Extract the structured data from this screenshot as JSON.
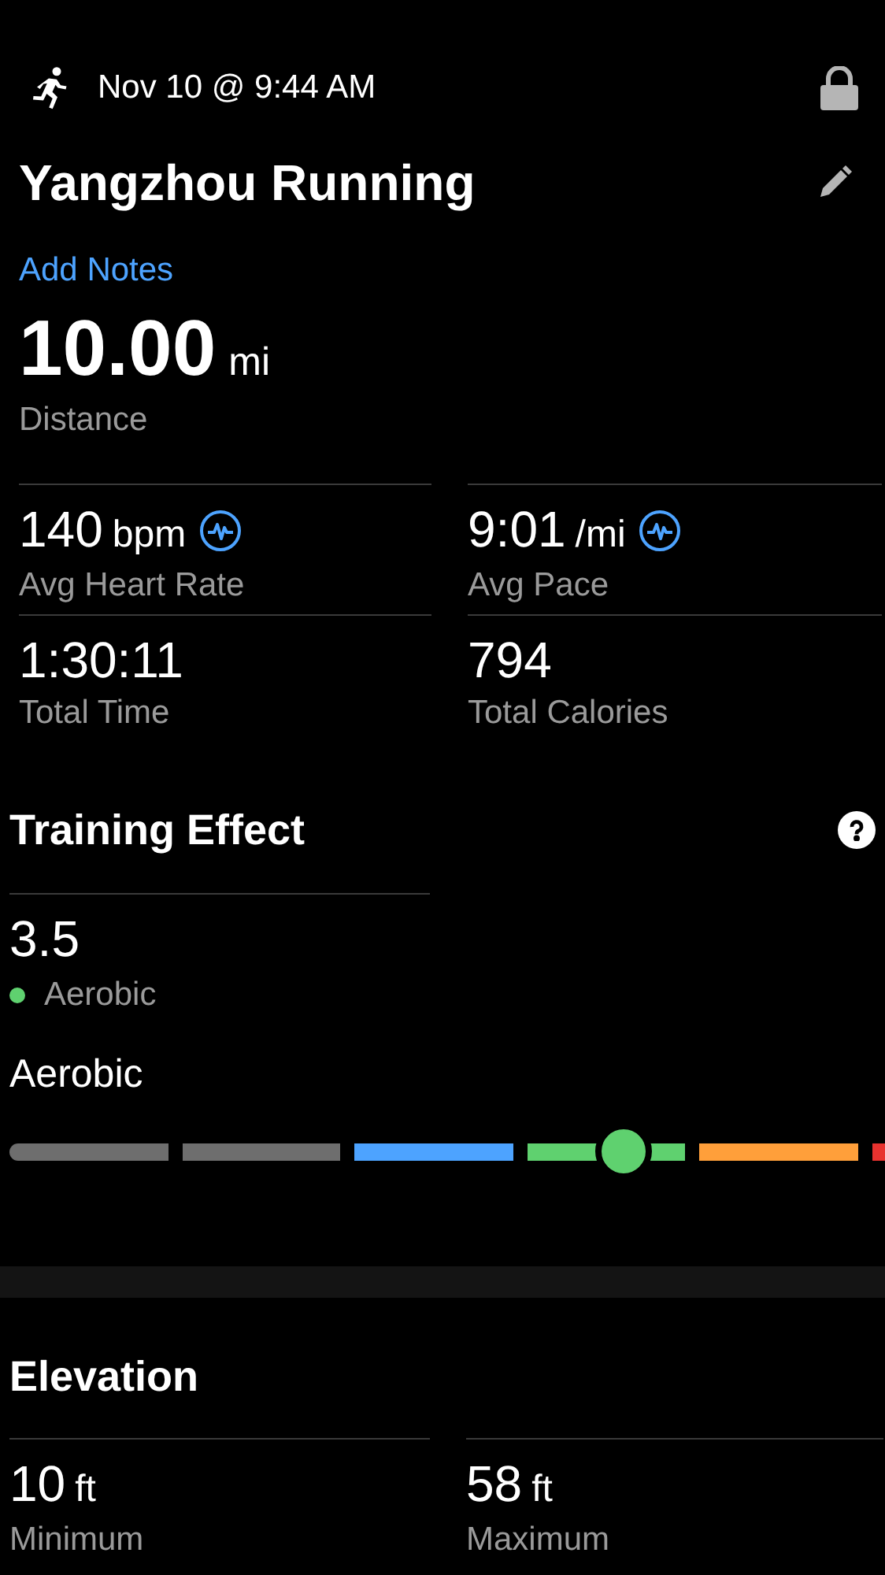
{
  "header": {
    "datetime": "Nov 10 @ 9:44 AM",
    "title": "Yangzhou Running",
    "add_notes": "Add Notes",
    "locked": true
  },
  "distance": {
    "value": "10.00",
    "unit": "mi",
    "label": "Distance"
  },
  "stats": [
    {
      "value": "140",
      "unit": "bpm",
      "label": "Avg Heart Rate",
      "chart_link": true
    },
    {
      "value": "9:01",
      "unit": "/mi",
      "label": "Avg Pace",
      "chart_link": true
    },
    {
      "value": "1:30:11",
      "label": "Total Time",
      "chart_link": false
    },
    {
      "value": "794",
      "label": "Total Calories",
      "chart_link": false
    }
  ],
  "training_effect": {
    "title": "Training Effect",
    "value": "3.5",
    "category": "Aerobic",
    "color": "#5fd16f",
    "gauge_title": "Aerobic",
    "segments": [
      {
        "color": "#6e6e6e"
      },
      {
        "color": "#6e6e6e"
      },
      {
        "color": "#4da3ff"
      },
      {
        "color": "#5fd16f"
      },
      {
        "color": "#ff9f3a"
      },
      {
        "color": "#e8322f"
      }
    ]
  },
  "elevation": {
    "title": "Elevation",
    "stats": [
      {
        "value": "10",
        "unit": "ft",
        "label": "Minimum"
      },
      {
        "value": "58",
        "unit": "ft",
        "label": "Maximum"
      }
    ]
  }
}
